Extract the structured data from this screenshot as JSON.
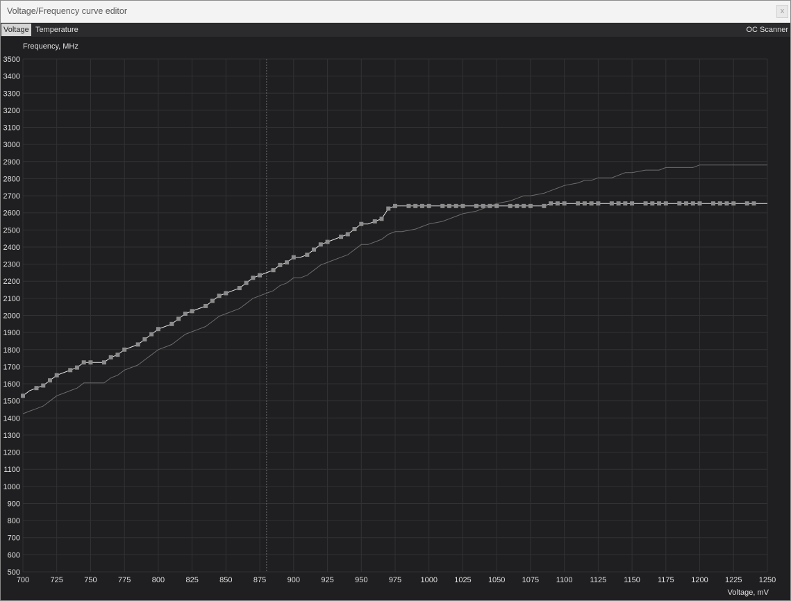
{
  "window": {
    "title": "Voltage/Frequency curve editor",
    "close_glyph": "x"
  },
  "tabs": [
    "Voltage",
    "Temperature"
  ],
  "active_tab": "Voltage",
  "oc_scanner_label": "OC Scanner",
  "colors": {
    "background": "#1f1f21",
    "grid": "#323234",
    "curve": "#e6e6e6",
    "default_curve": "#6c6c6c",
    "point": "#8c8c8c"
  },
  "chart_data": {
    "type": "line",
    "ylabel": "Frequency, MHz",
    "xlabel": "Voltage, mV",
    "xlim": [
      700,
      1250
    ],
    "ylim": [
      500,
      3500
    ],
    "x_ticks": [
      700,
      725,
      750,
      775,
      800,
      825,
      850,
      875,
      900,
      925,
      950,
      975,
      1000,
      1025,
      1050,
      1075,
      1100,
      1125,
      1150,
      1175,
      1200,
      1225,
      1250
    ],
    "y_ticks": [
      500,
      600,
      700,
      800,
      900,
      1000,
      1100,
      1200,
      1300,
      1400,
      1500,
      1600,
      1700,
      1800,
      1900,
      2000,
      2100,
      2200,
      2300,
      2400,
      2500,
      2600,
      2700,
      2800,
      2900,
      3000,
      3100,
      3200,
      3300,
      3400,
      3500
    ],
    "grid": true,
    "cursor_x": 880,
    "series": [
      {
        "values": [
          [
            700,
            1530
          ],
          [
            705,
            1560
          ],
          [
            710,
            1575
          ],
          [
            715,
            1590
          ],
          [
            720,
            1620
          ],
          [
            725,
            1650
          ],
          [
            730,
            1665
          ],
          [
            735,
            1680
          ],
          [
            740,
            1695
          ],
          [
            745,
            1725
          ],
          [
            750,
            1725
          ],
          [
            760,
            1725
          ],
          [
            765,
            1755
          ],
          [
            770,
            1770
          ],
          [
            775,
            1800
          ],
          [
            780,
            1815
          ],
          [
            785,
            1830
          ],
          [
            790,
            1860
          ],
          [
            795,
            1890
          ],
          [
            800,
            1920
          ],
          [
            805,
            1935
          ],
          [
            810,
            1950
          ],
          [
            815,
            1980
          ],
          [
            820,
            2010
          ],
          [
            825,
            2025
          ],
          [
            830,
            2040
          ],
          [
            835,
            2055
          ],
          [
            840,
            2085
          ],
          [
            845,
            2115
          ],
          [
            850,
            2130
          ],
          [
            855,
            2145
          ],
          [
            860,
            2160
          ],
          [
            865,
            2190
          ],
          [
            870,
            2220
          ],
          [
            875,
            2235
          ],
          [
            880,
            2250
          ],
          [
            885,
            2265
          ],
          [
            890,
            2295
          ],
          [
            895,
            2310
          ],
          [
            900,
            2340
          ],
          [
            905,
            2340
          ],
          [
            910,
            2355
          ],
          [
            915,
            2385
          ],
          [
            920,
            2415
          ],
          [
            925,
            2430
          ],
          [
            930,
            2445
          ],
          [
            935,
            2460
          ],
          [
            940,
            2475
          ],
          [
            945,
            2505
          ],
          [
            950,
            2535
          ],
          [
            955,
            2535
          ],
          [
            960,
            2550
          ],
          [
            965,
            2565
          ],
          [
            970,
            2625
          ],
          [
            975,
            2640
          ],
          [
            980,
            2640
          ],
          [
            985,
            2640
          ],
          [
            990,
            2640
          ],
          [
            995,
            2640
          ],
          [
            1000,
            2640
          ],
          [
            1010,
            2640
          ],
          [
            1015,
            2640
          ],
          [
            1020,
            2640
          ],
          [
            1025,
            2640
          ],
          [
            1035,
            2640
          ],
          [
            1040,
            2640
          ],
          [
            1045,
            2640
          ],
          [
            1050,
            2640
          ],
          [
            1060,
            2640
          ],
          [
            1065,
            2640
          ],
          [
            1070,
            2640
          ],
          [
            1075,
            2640
          ],
          [
            1085,
            2640
          ],
          [
            1090,
            2655
          ],
          [
            1095,
            2655
          ],
          [
            1100,
            2655
          ],
          [
            1110,
            2655
          ],
          [
            1115,
            2655
          ],
          [
            1120,
            2655
          ],
          [
            1125,
            2655
          ],
          [
            1135,
            2655
          ],
          [
            1140,
            2655
          ],
          [
            1145,
            2655
          ],
          [
            1150,
            2655
          ],
          [
            1160,
            2655
          ],
          [
            1165,
            2655
          ],
          [
            1170,
            2655
          ],
          [
            1175,
            2655
          ],
          [
            1185,
            2655
          ],
          [
            1190,
            2655
          ],
          [
            1195,
            2655
          ],
          [
            1200,
            2655
          ],
          [
            1210,
            2655
          ],
          [
            1215,
            2655
          ],
          [
            1220,
            2655
          ],
          [
            1225,
            2655
          ],
          [
            1235,
            2655
          ],
          [
            1240,
            2655
          ],
          [
            1250,
            2655
          ]
        ],
        "points": [
          [
            700,
            1530
          ],
          [
            710,
            1575
          ],
          [
            715,
            1590
          ],
          [
            720,
            1620
          ],
          [
            725,
            1650
          ],
          [
            735,
            1680
          ],
          [
            740,
            1695
          ],
          [
            745,
            1725
          ],
          [
            750,
            1725
          ],
          [
            760,
            1725
          ],
          [
            765,
            1755
          ],
          [
            770,
            1770
          ],
          [
            775,
            1800
          ],
          [
            785,
            1830
          ],
          [
            790,
            1860
          ],
          [
            795,
            1890
          ],
          [
            800,
            1920
          ],
          [
            810,
            1950
          ],
          [
            815,
            1980
          ],
          [
            820,
            2010
          ],
          [
            825,
            2025
          ],
          [
            835,
            2055
          ],
          [
            840,
            2085
          ],
          [
            845,
            2115
          ],
          [
            850,
            2130
          ],
          [
            860,
            2160
          ],
          [
            865,
            2190
          ],
          [
            870,
            2220
          ],
          [
            875,
            2235
          ],
          [
            885,
            2265
          ],
          [
            890,
            2295
          ],
          [
            895,
            2310
          ],
          [
            900,
            2340
          ],
          [
            910,
            2355
          ],
          [
            915,
            2385
          ],
          [
            920,
            2415
          ],
          [
            925,
            2430
          ],
          [
            935,
            2460
          ],
          [
            940,
            2475
          ],
          [
            945,
            2505
          ],
          [
            950,
            2535
          ],
          [
            960,
            2550
          ],
          [
            965,
            2565
          ],
          [
            970,
            2625
          ],
          [
            975,
            2640
          ],
          [
            985,
            2640
          ],
          [
            990,
            2640
          ],
          [
            995,
            2640
          ],
          [
            1000,
            2640
          ],
          [
            1010,
            2640
          ],
          [
            1015,
            2640
          ],
          [
            1020,
            2640
          ],
          [
            1025,
            2640
          ],
          [
            1035,
            2640
          ],
          [
            1040,
            2640
          ],
          [
            1045,
            2640
          ],
          [
            1050,
            2640
          ],
          [
            1060,
            2640
          ],
          [
            1065,
            2640
          ],
          [
            1070,
            2640
          ],
          [
            1075,
            2640
          ],
          [
            1085,
            2640
          ],
          [
            1090,
            2655
          ],
          [
            1095,
            2655
          ],
          [
            1100,
            2655
          ],
          [
            1110,
            2655
          ],
          [
            1115,
            2655
          ],
          [
            1120,
            2655
          ],
          [
            1125,
            2655
          ],
          [
            1135,
            2655
          ],
          [
            1140,
            2655
          ],
          [
            1145,
            2655
          ],
          [
            1150,
            2655
          ],
          [
            1160,
            2655
          ],
          [
            1165,
            2655
          ],
          [
            1170,
            2655
          ],
          [
            1175,
            2655
          ],
          [
            1185,
            2655
          ],
          [
            1190,
            2655
          ],
          [
            1195,
            2655
          ],
          [
            1200,
            2655
          ],
          [
            1210,
            2655
          ],
          [
            1215,
            2655
          ],
          [
            1220,
            2655
          ],
          [
            1225,
            2655
          ],
          [
            1235,
            2655
          ],
          [
            1240,
            2655
          ]
        ]
      },
      {
        "values": [
          [
            700,
            1425
          ],
          [
            705,
            1440
          ],
          [
            710,
            1455
          ],
          [
            715,
            1470
          ],
          [
            720,
            1500
          ],
          [
            725,
            1530
          ],
          [
            730,
            1545
          ],
          [
            735,
            1560
          ],
          [
            740,
            1575
          ],
          [
            745,
            1605
          ],
          [
            750,
            1605
          ],
          [
            760,
            1605
          ],
          [
            765,
            1635
          ],
          [
            770,
            1650
          ],
          [
            775,
            1680
          ],
          [
            780,
            1695
          ],
          [
            785,
            1710
          ],
          [
            790,
            1740
          ],
          [
            795,
            1770
          ],
          [
            800,
            1800
          ],
          [
            805,
            1815
          ],
          [
            810,
            1830
          ],
          [
            815,
            1860
          ],
          [
            820,
            1890
          ],
          [
            825,
            1905
          ],
          [
            830,
            1920
          ],
          [
            835,
            1935
          ],
          [
            840,
            1965
          ],
          [
            845,
            1995
          ],
          [
            850,
            2010
          ],
          [
            855,
            2025
          ],
          [
            860,
            2040
          ],
          [
            865,
            2070
          ],
          [
            870,
            2100
          ],
          [
            875,
            2115
          ],
          [
            880,
            2130
          ],
          [
            885,
            2145
          ],
          [
            890,
            2175
          ],
          [
            895,
            2190
          ],
          [
            900,
            2220
          ],
          [
            905,
            2220
          ],
          [
            910,
            2235
          ],
          [
            915,
            2265
          ],
          [
            920,
            2295
          ],
          [
            925,
            2310
          ],
          [
            930,
            2325
          ],
          [
            935,
            2340
          ],
          [
            940,
            2355
          ],
          [
            945,
            2385
          ],
          [
            950,
            2415
          ],
          [
            955,
            2415
          ],
          [
            960,
            2430
          ],
          [
            965,
            2445
          ],
          [
            970,
            2475
          ],
          [
            975,
            2490
          ],
          [
            980,
            2490
          ],
          [
            990,
            2505
          ],
          [
            995,
            2520
          ],
          [
            1000,
            2535
          ],
          [
            1010,
            2550
          ],
          [
            1015,
            2565
          ],
          [
            1020,
            2580
          ],
          [
            1025,
            2595
          ],
          [
            1035,
            2610
          ],
          [
            1040,
            2625
          ],
          [
            1045,
            2640
          ],
          [
            1050,
            2655
          ],
          [
            1060,
            2670
          ],
          [
            1065,
            2685
          ],
          [
            1070,
            2700
          ],
          [
            1075,
            2700
          ],
          [
            1085,
            2715
          ],
          [
            1090,
            2730
          ],
          [
            1095,
            2745
          ],
          [
            1100,
            2760
          ],
          [
            1110,
            2775
          ],
          [
            1115,
            2790
          ],
          [
            1120,
            2790
          ],
          [
            1125,
            2805
          ],
          [
            1135,
            2805
          ],
          [
            1140,
            2820
          ],
          [
            1145,
            2835
          ],
          [
            1150,
            2835
          ],
          [
            1160,
            2850
          ],
          [
            1165,
            2850
          ],
          [
            1170,
            2850
          ],
          [
            1175,
            2865
          ],
          [
            1185,
            2865
          ],
          [
            1190,
            2865
          ],
          [
            1195,
            2865
          ],
          [
            1200,
            2880
          ],
          [
            1210,
            2880
          ],
          [
            1215,
            2880
          ],
          [
            1220,
            2880
          ],
          [
            1225,
            2880
          ],
          [
            1235,
            2880
          ],
          [
            1240,
            2880
          ],
          [
            1250,
            2880
          ]
        ]
      }
    ]
  }
}
